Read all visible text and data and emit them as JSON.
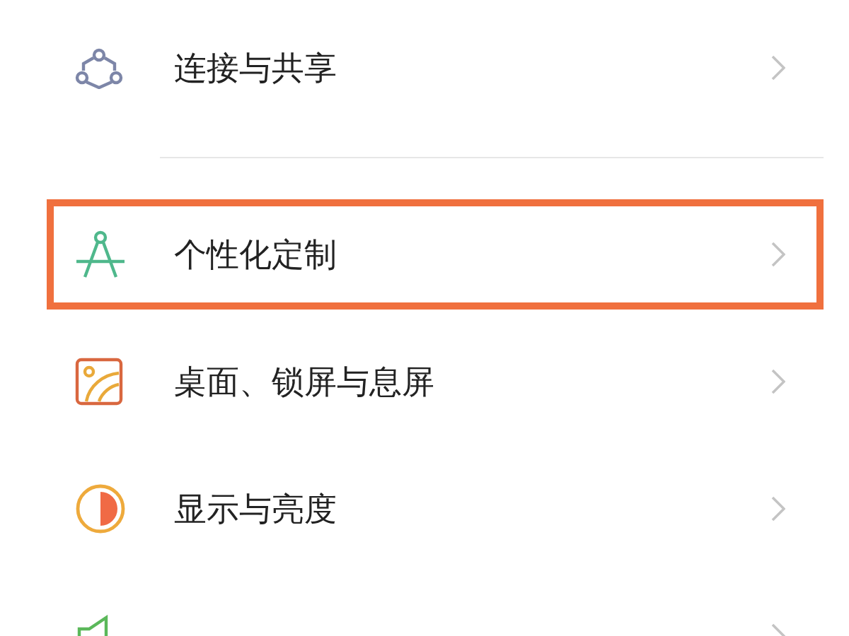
{
  "settings_groups": [
    {
      "items": [
        {
          "label": "连接与共享",
          "highlighted": false
        }
      ]
    },
    {
      "items": [
        {
          "label": "个性化定制",
          "highlighted": true
        },
        {
          "label": "桌面、锁屏与息屏",
          "highlighted": false
        },
        {
          "label": "显示与亮度",
          "highlighted": false
        },
        {
          "highlighted": false
        }
      ]
    }
  ]
}
